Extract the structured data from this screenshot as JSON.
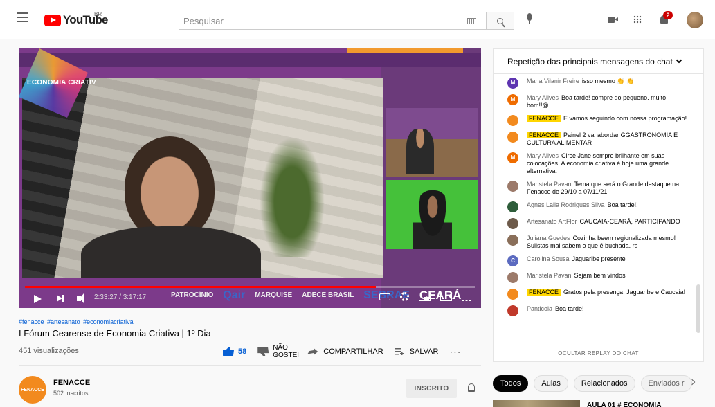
{
  "header": {
    "logo_text": "YouTube",
    "country": "BR",
    "search_placeholder": "Pesquisar",
    "notification_count": "2"
  },
  "player": {
    "brand_text": "ECONOMIA CRIATIV",
    "sponsors": [
      "PATROCÍNIO",
      "Qair",
      "MARQUISE",
      "ADECE BRASIL",
      "SEBRAE",
      "CEARÁ"
    ],
    "time": "2:33:27 / 3:17:17",
    "progress": 0.78
  },
  "video": {
    "hashtags": [
      "#fenacce",
      "#artesanato",
      "#economiacriativa"
    ],
    "title": "I Fórum Cearense de Economia Criativa | 1º Dia",
    "views": "451 visualizações",
    "likes": "58",
    "dislike_label": "NÃO GOSTEI",
    "share_label": "COMPARTILHAR",
    "save_label": "SALVAR",
    "more": "···"
  },
  "channel": {
    "avatar_text": "FENACCE",
    "name": "FENACCE",
    "subscribers": "502 inscritos",
    "subscribed_label": "INSCRITO"
  },
  "chat": {
    "header": "Repetição das principais mensagens do chat",
    "footer": "OCULTAR REPLAY DO CHAT",
    "messages": [
      {
        "author": "Maria Vilanir Freire",
        "text": "isso mesmo 👏 👏",
        "initial": "M",
        "color": "#5e35b1",
        "owner": false
      },
      {
        "author": "Mary Allves",
        "text": "Boa tarde! compre do pequeno. muito bom!!@",
        "initial": "M",
        "color": "#ef6c00",
        "owner": false
      },
      {
        "author": "FENACCE",
        "text": "E vamos seguindo com nossa programação!",
        "initial": "",
        "color": "#f28a1e",
        "owner": true
      },
      {
        "author": "FENACCE",
        "text": "Painel 2 vai abordar GGASTRONOMIA E CULTURA ALIMENTAR",
        "initial": "",
        "color": "#f28a1e",
        "owner": true
      },
      {
        "author": "Mary Allves",
        "text": "Circe Jane sempre brilhante em suas colocações. A economia criativa é hoje uma grande alternativa.",
        "initial": "M",
        "color": "#ef6c00",
        "owner": false
      },
      {
        "author": "Maristela Pavan",
        "text": "Tema que será o Grande destaque na Fenacce de 29/10 a 07/11/21",
        "initial": "",
        "color": "#9c7a6a",
        "owner": false
      },
      {
        "author": "Agnes Laila Rodrigues Silva",
        "text": "Boa tarde!!",
        "initial": "",
        "color": "#2e5d3a",
        "owner": false
      },
      {
        "author": "Artesanato ArtFlor",
        "text": "CAUCAIA-CEARÁ, PARTICIPANDO",
        "initial": "",
        "color": "#6d5a4a",
        "owner": false
      },
      {
        "author": "Juliana Guedes",
        "text": "Cozinha beem regionalizada mesmo! Sulistas mal sabem o que é buchada. rs",
        "initial": "",
        "color": "#8a6f5a",
        "owner": false
      },
      {
        "author": "Carolina Sousa",
        "text": "Jaguaribe presente",
        "initial": "C",
        "color": "#5c6bc0",
        "owner": false
      },
      {
        "author": "Maristela Pavan",
        "text": "Sejam bem vindos",
        "initial": "",
        "color": "#9c7a6a",
        "owner": false
      },
      {
        "author": "FENACCE",
        "text": "Gratos pela presença, Jaguaribe e Caucaia!",
        "initial": "",
        "color": "#f28a1e",
        "owner": true
      },
      {
        "author": "Panticola",
        "text": "Boa tarde!",
        "initial": "",
        "color": "#c0392b",
        "owner": false
      }
    ]
  },
  "chips": [
    "Todos",
    "Aulas",
    "Relacionados",
    "Enviados r"
  ],
  "recommendation": {
    "title": "AULA 01 # ECONOMIA"
  }
}
